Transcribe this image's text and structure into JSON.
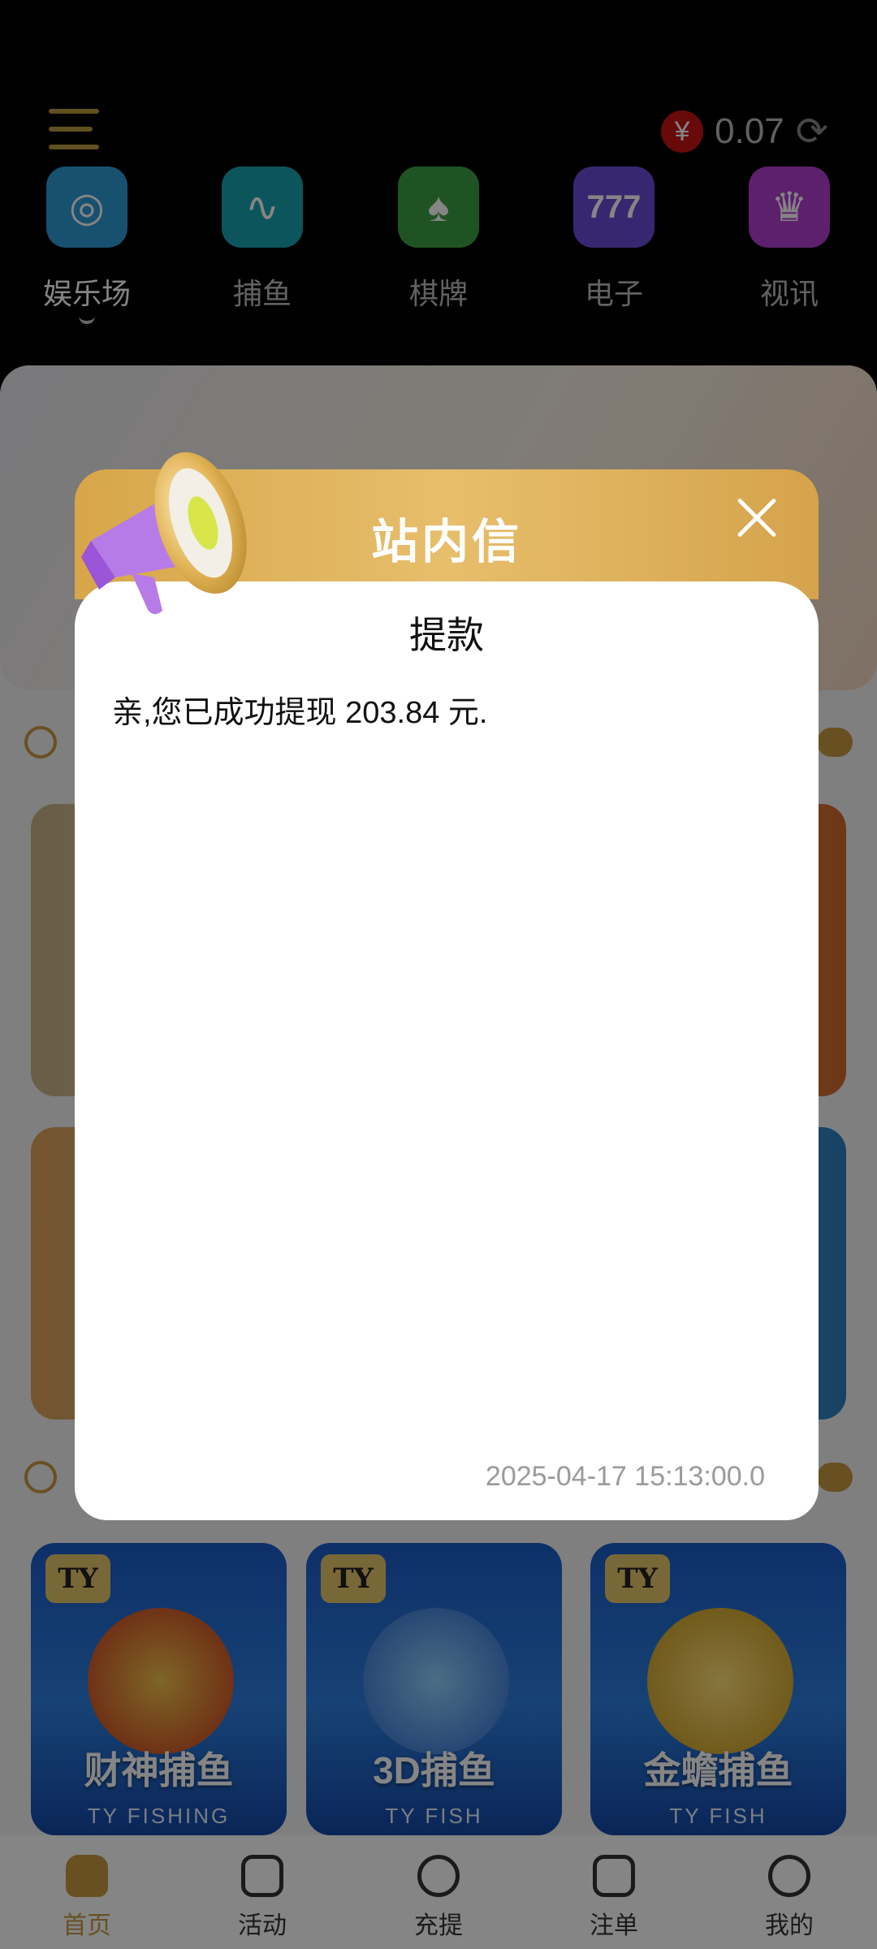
{
  "header": {
    "balance": {
      "currency_symbol": "¥",
      "amount": "0.07"
    }
  },
  "categories": [
    {
      "label": "娱乐场",
      "icon": "casino-roulette-icon",
      "color": "#2e9ad6",
      "active": true
    },
    {
      "label": "捕鱼",
      "icon": "fishing-icon",
      "color": "#1aa3b0",
      "active": false
    },
    {
      "label": "棋牌",
      "icon": "spade-icon",
      "color": "#3ea046",
      "active": false
    },
    {
      "label": "电子",
      "icon": "slot-777-icon",
      "color": "#6a4bd6",
      "active": false
    },
    {
      "label": "视讯",
      "icon": "live-dealer-icon",
      "color": "#b23fd0",
      "active": false
    }
  ],
  "fishing_games": [
    {
      "title": "财神捕鱼",
      "subtitle": "TY FISHING",
      "brand": "TY"
    },
    {
      "title": "3D捕鱼",
      "subtitle": "TY FISH",
      "brand": "TY"
    },
    {
      "title": "金蟾捕鱼",
      "subtitle": "TY FISH",
      "brand": "TY"
    }
  ],
  "tabbar": [
    {
      "label": "首页",
      "active": true
    },
    {
      "label": "活动",
      "active": false
    },
    {
      "label": "充提",
      "active": false
    },
    {
      "label": "注单",
      "active": false
    },
    {
      "label": "我的",
      "active": false
    }
  ],
  "modal": {
    "title": "站内信",
    "message_title": "提款",
    "message_text": "亲,您已成功提现 203.84 元.",
    "timestamp": "2025-04-17 15:13:00.0"
  },
  "colors": {
    "accent_gold": "#c89a44",
    "modal_header": "#dcae55"
  }
}
